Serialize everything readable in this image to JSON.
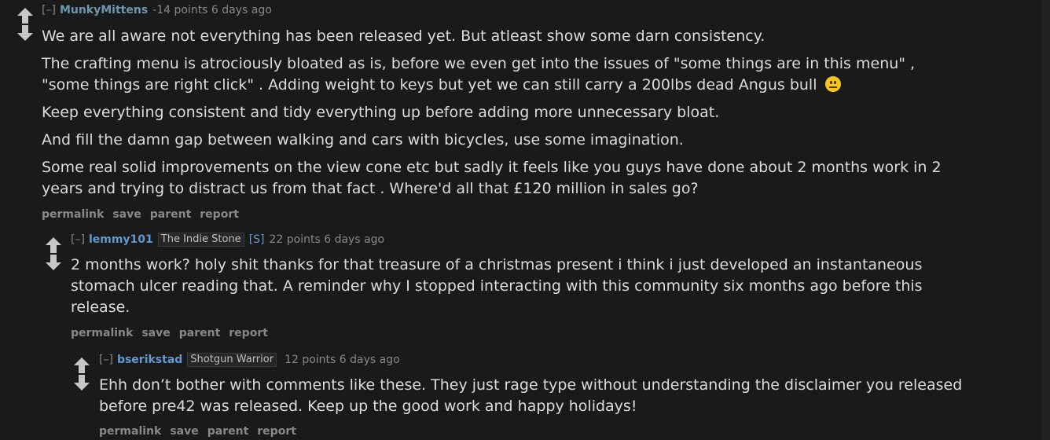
{
  "comments": [
    {
      "expand": "[–]",
      "author": "MunkyMittens",
      "flair": "",
      "admin": "",
      "score": "-14 points 6 days ago",
      "paragraphs": [
        "We are all aware not everything has been released yet. But atleast show some darn consistency.",
        "The crafting menu is atrociously bloated as is, before we even get into the issues of \"some things are in this menu\" , \"some things are right click\" . Adding weight to keys but yet we can still carry a 200lbs dead Angus bull",
        "Keep everything consistent and tidy everything up before adding more unnecessary bloat.",
        "And fill the damn gap between walking and cars with bicycles, use some imagination.",
        "Some real solid improvements on the view cone etc but sadly it feels like you guys have done about 2 months work in 2 years and trying to distract us from that fact . Where'd all that £120 million in sales go?"
      ],
      "emoji_icon": "neutral-face-emoji",
      "buttons": [
        "permalink",
        "save",
        "parent",
        "report"
      ]
    },
    {
      "expand": "[–]",
      "author": "lemmy101",
      "flair": "The Indie Stone",
      "admin": "[S]",
      "score": "22 points 6 days ago",
      "paragraphs": [
        "2 months work? holy shit thanks for that treasure of a christmas present i think i just developed an instantaneous stomach ulcer reading that. A reminder why I stopped interacting with this community six months ago before this release."
      ],
      "buttons": [
        "permalink",
        "save",
        "parent",
        "report"
      ]
    },
    {
      "expand": "[–]",
      "author": "bserikstad",
      "flair": "Shotgun Warrior",
      "admin": "",
      "score": "12 points 6 days ago",
      "paragraphs": [
        "Ehh don’t bother with comments like these. They just rage type without understanding the disclaimer you released before pre42 was released. Keep up the good work and happy holidays!"
      ],
      "buttons": [
        "permalink",
        "save",
        "parent",
        "report"
      ]
    }
  ],
  "colors": {
    "background": "#1a1a1b",
    "text": "#d7dadc",
    "meta": "#888888",
    "author": "#5f99cf",
    "arrow": "#c8c8c8"
  }
}
